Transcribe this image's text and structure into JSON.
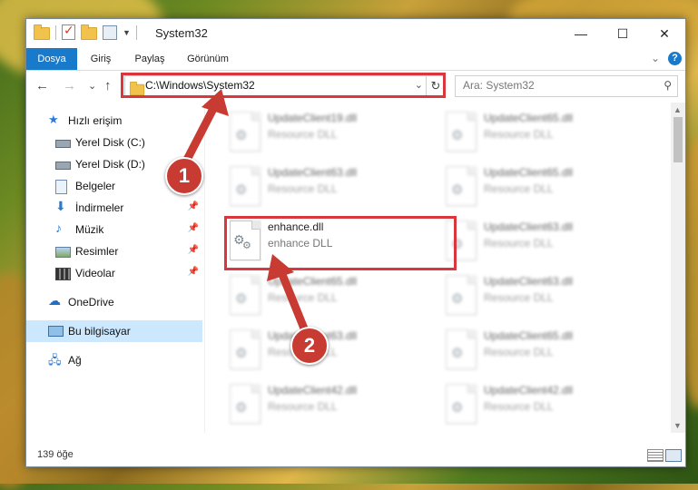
{
  "window": {
    "title": "System32",
    "minimize_glyph": "—",
    "maximize_glyph": "☐",
    "close_glyph": "✕"
  },
  "ribbon": {
    "tabs": [
      {
        "label": "Dosya",
        "active": true
      },
      {
        "label": "Giriş",
        "active": false
      },
      {
        "label": "Paylaş",
        "active": false
      },
      {
        "label": "Görünüm",
        "active": false
      }
    ],
    "expand_glyph": "⌄",
    "help_glyph": "?"
  },
  "navigation": {
    "back_glyph": "←",
    "forward_glyph": "→",
    "recent_glyph": "⌄",
    "up_glyph": "↑",
    "address": "C:\\Windows\\System32",
    "address_dropdown_glyph": "⌄",
    "refresh_glyph": "↻",
    "search_placeholder": "Ara: System32",
    "search_glyph": "⚲"
  },
  "sidebar": {
    "items": [
      {
        "label": "Hızlı erişim",
        "icon": "star-icon",
        "pinned": false,
        "selected": false
      },
      {
        "label": "Yerel Disk (C:)",
        "icon": "drive-icon",
        "pinned": false,
        "selected": false
      },
      {
        "label": "Yerel Disk (D:)",
        "icon": "drive-icon",
        "pinned": false,
        "selected": false
      },
      {
        "label": "Belgeler",
        "icon": "documents-icon",
        "pinned": true,
        "selected": false
      },
      {
        "label": "İndirmeler",
        "icon": "download-icon",
        "pinned": true,
        "selected": false
      },
      {
        "label": "Müzik",
        "icon": "music-icon",
        "pinned": true,
        "selected": false
      },
      {
        "label": "Resimler",
        "icon": "pictures-icon",
        "pinned": true,
        "selected": false
      },
      {
        "label": "Videolar",
        "icon": "video-icon",
        "pinned": true,
        "selected": false
      },
      {
        "label": "OneDrive",
        "icon": "cloud-icon",
        "pinned": false,
        "selected": false
      },
      {
        "label": "Bu bilgisayar",
        "icon": "computer-icon",
        "pinned": false,
        "selected": true
      },
      {
        "label": "Ağ",
        "icon": "network-icon",
        "pinned": false,
        "selected": false
      }
    ],
    "pin_glyph": "📌"
  },
  "files": [
    {
      "name": "UpdateClient19.dll",
      "desc": "Resource DLL",
      "blurred": true
    },
    {
      "name": "UpdateClient65.dll",
      "desc": "Resource DLL",
      "blurred": true
    },
    {
      "name": "UpdateClient63.dll",
      "desc": "Resource DLL",
      "blurred": true
    },
    {
      "name": "UpdateClient65.dll",
      "desc": "Resource DLL",
      "blurred": true
    },
    {
      "name": "enhance.dll",
      "desc": "enhance DLL",
      "blurred": false
    },
    {
      "name": "UpdateClient63.dll",
      "desc": "Resource DLL",
      "blurred": true
    },
    {
      "name": "UpdateClient65.dll",
      "desc": "Resource DLL",
      "blurred": true
    },
    {
      "name": "UpdateClient63.dll",
      "desc": "Resource DLL",
      "blurred": true
    },
    {
      "name": "UpdateClient63.dll",
      "desc": "Resource DLL",
      "blurred": true
    },
    {
      "name": "UpdateClient65.dll",
      "desc": "Resource DLL",
      "blurred": true
    },
    {
      "name": "UpdateClient42.dll",
      "desc": "Resource DLL",
      "blurred": true
    },
    {
      "name": "UpdateClient42.dll",
      "desc": "Resource DLL",
      "blurred": true
    }
  ],
  "status": {
    "item_count": "139 öğe"
  },
  "annotations": {
    "step1": "1",
    "step2": "2",
    "highlight_color": "#d9363e",
    "badge_color": "#c83b32"
  }
}
